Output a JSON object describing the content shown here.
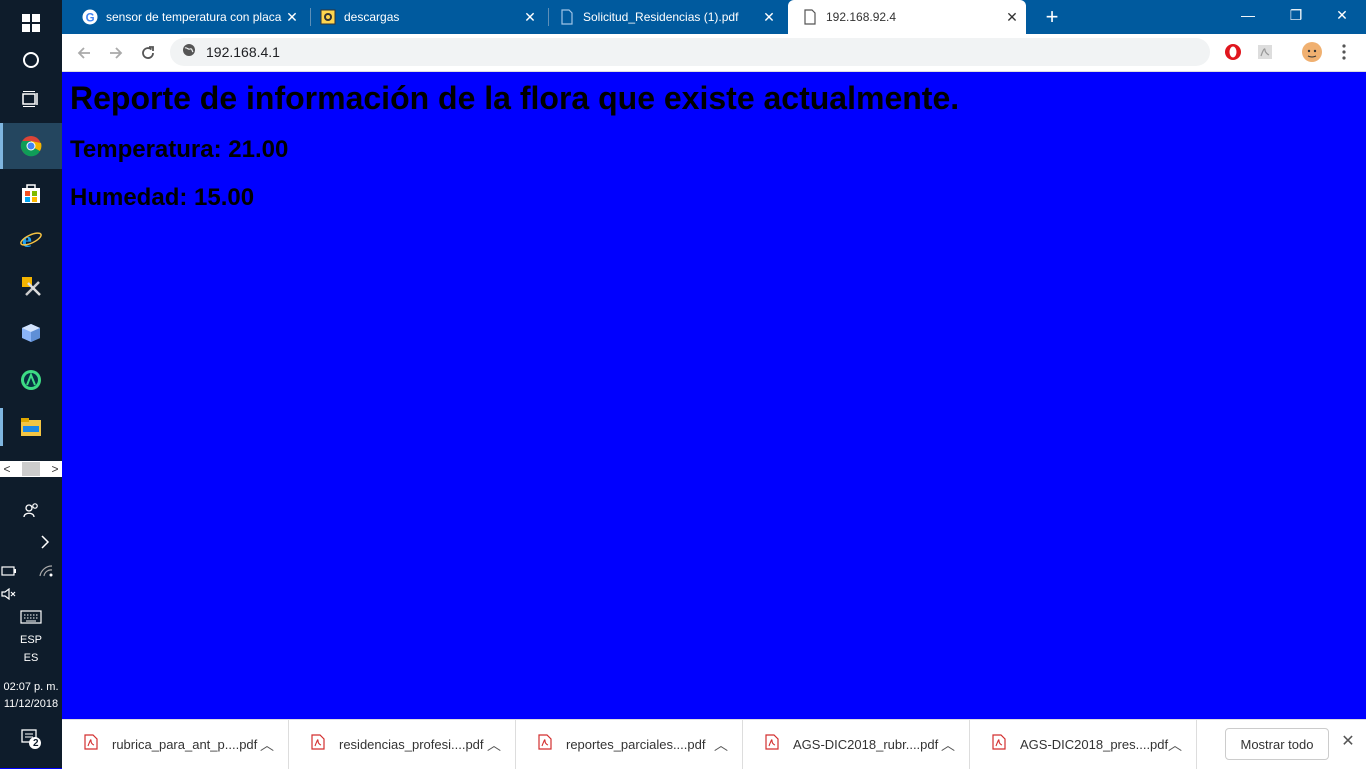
{
  "browser": {
    "tabs": [
      {
        "title": "sensor de temperatura con placa",
        "favicon": "google-icon"
      },
      {
        "title": "descargas",
        "favicon": "folder-icon"
      },
      {
        "title": "Solicitud_Residencias (1).pdf",
        "favicon": "document-icon"
      },
      {
        "title": "192.168.92.4",
        "favicon": "document-icon",
        "active": true
      }
    ],
    "new_tab": "+",
    "window_controls": {
      "minimize": "—",
      "maximize": "❐",
      "close": "✕"
    },
    "address": "192.168.4.1"
  },
  "page": {
    "heading": "Reporte de información de la flora que existe actualmente.",
    "temperature": "Temperatura: 21.00",
    "humidity": "Humedad: 15.00",
    "background_color": "#0000ff"
  },
  "downloads": {
    "items": [
      {
        "name": "rubrica_para_ant_p....pdf"
      },
      {
        "name": "residencias_profesi....pdf"
      },
      {
        "name": "reportes_parciales....pdf"
      },
      {
        "name": "AGS-DIC2018_rubr....pdf"
      },
      {
        "name": "AGS-DIC2018_pres....pdf"
      }
    ],
    "show_all": "Mostrar todo"
  },
  "taskbar": {
    "language": "ESP",
    "layout": "ES",
    "time": "02:07 p. m.",
    "date": "11/12/2018",
    "notifications_count": "2"
  }
}
